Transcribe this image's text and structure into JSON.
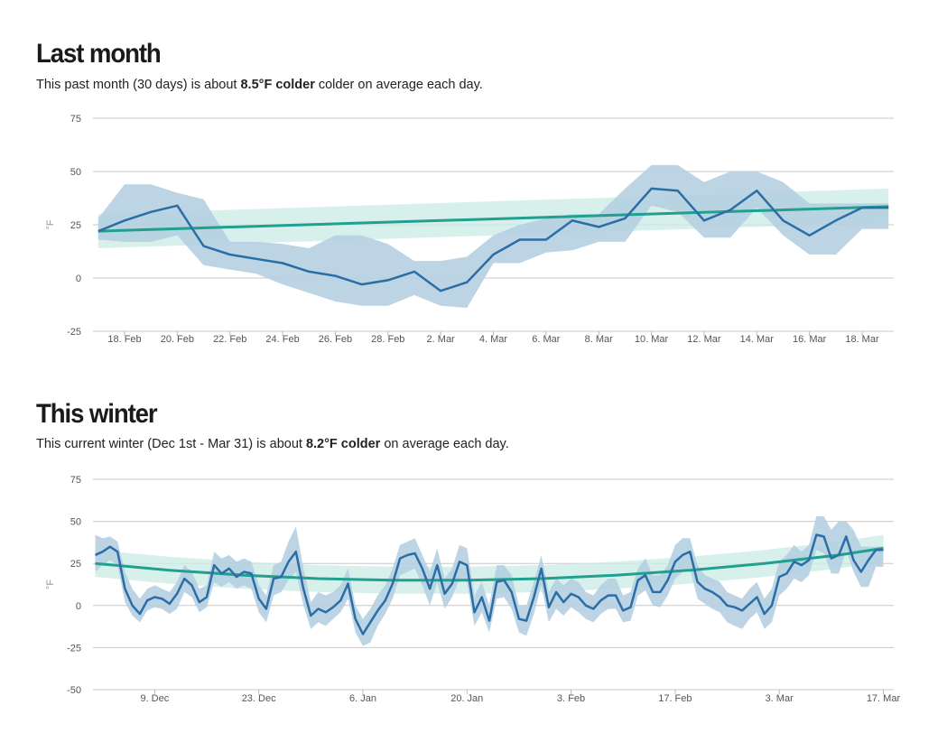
{
  "sections": [
    {
      "heading": "Last month",
      "desc_pre": "This past month (30 days) is about ",
      "desc_bold": "8.5°F colder",
      "desc_post": " colder on average each day."
    },
    {
      "heading": "This winter",
      "desc_pre": "This current winter (Dec 1st - Mar 31) is about ",
      "desc_bold": "8.2°F colder",
      "desc_post": " on average each day."
    }
  ],
  "colors": {
    "line": "#2b6ea6",
    "band": "#b5cfe1",
    "normal": "#20a08f",
    "normal_band": "#cdece6",
    "grid": "#c8c8c8"
  },
  "chart_data": [
    {
      "type": "line",
      "ylabel": "°F",
      "ylim": [
        -25,
        75
      ],
      "yticks": [
        -25,
        0,
        25,
        50,
        75
      ],
      "x_start": 16.8,
      "x_end": 47.2,
      "x_unit": "days since Feb 1",
      "xticks": [
        {
          "x": 18,
          "label": "18. Feb"
        },
        {
          "x": 20,
          "label": "20. Feb"
        },
        {
          "x": 22,
          "label": "22. Feb"
        },
        {
          "x": 24,
          "label": "24. Feb"
        },
        {
          "x": 26,
          "label": "26. Feb"
        },
        {
          "x": 28,
          "label": "28. Feb"
        },
        {
          "x": 30,
          "label": "2. Mar"
        },
        {
          "x": 32,
          "label": "4. Mar"
        },
        {
          "x": 34,
          "label": "6. Mar"
        },
        {
          "x": 36,
          "label": "8. Mar"
        },
        {
          "x": 38,
          "label": "10. Mar"
        },
        {
          "x": 40,
          "label": "12. Mar"
        },
        {
          "x": 42,
          "label": "14. Mar"
        },
        {
          "x": 44,
          "label": "16. Mar"
        },
        {
          "x": 46,
          "label": "18. Mar"
        }
      ],
      "series": [
        {
          "x": [
            17,
            18,
            19,
            20,
            21,
            22,
            23,
            24,
            25,
            26,
            27,
            28,
            29,
            30,
            31,
            32,
            33,
            34,
            35,
            36,
            37,
            38,
            39,
            40,
            41,
            42,
            43,
            44,
            45,
            46,
            47
          ],
          "y": [
            22,
            27,
            31,
            34,
            15,
            11,
            9,
            7,
            3,
            1,
            -3,
            -1,
            3,
            -6,
            -2,
            11,
            18,
            18,
            27,
            24,
            28,
            42,
            41,
            27,
            32,
            41,
            27,
            20,
            27,
            33,
            33
          ],
          "low": [
            18,
            17,
            17,
            20,
            6,
            4,
            2,
            -3,
            -7,
            -11,
            -13,
            -13,
            -8,
            -13,
            -14,
            7,
            7,
            12,
            13,
            17,
            17,
            34,
            31,
            19,
            19,
            33,
            20,
            11,
            11,
            23,
            23
          ],
          "high": [
            28,
            44,
            44,
            40,
            37,
            17,
            17,
            16,
            14,
            20,
            20,
            16,
            8,
            8,
            10,
            20,
            25,
            28,
            30,
            30,
            42,
            53,
            53,
            45,
            50,
            50,
            45,
            35,
            35,
            35,
            35
          ]
        }
      ],
      "normal": {
        "x": [
          17,
          47
        ],
        "y": [
          22,
          33.5
        ],
        "low": [
          14,
          26
        ],
        "high": [
          30,
          42
        ]
      }
    },
    {
      "type": "line",
      "ylabel": "°F",
      "ylim": [
        -50,
        75
      ],
      "yticks": [
        -50,
        -25,
        0,
        25,
        50,
        75
      ],
      "x_start": -0.3,
      "x_end": 107.4,
      "x_unit": "days since Dec 1",
      "xticks": [
        {
          "x": 8,
          "label": "9. Dec"
        },
        {
          "x": 22,
          "label": "23. Dec"
        },
        {
          "x": 36,
          "label": "6. Jan"
        },
        {
          "x": 50,
          "label": "20. Jan"
        },
        {
          "x": 64,
          "label": "3. Feb"
        },
        {
          "x": 78,
          "label": "17. Feb"
        },
        {
          "x": 92,
          "label": "3. Mar"
        },
        {
          "x": 106,
          "label": "17. Mar"
        }
      ],
      "series": [
        {
          "x": [
            0,
            1,
            2,
            3,
            4,
            5,
            6,
            7,
            8,
            9,
            10,
            11,
            12,
            13,
            14,
            15,
            16,
            17,
            18,
            19,
            20,
            21,
            22,
            23,
            24,
            25,
            26,
            27,
            28,
            29,
            30,
            31,
            32,
            33,
            34,
            35,
            36,
            37,
            38,
            39,
            40,
            41,
            42,
            43,
            44,
            45,
            46,
            47,
            48,
            49,
            50,
            51,
            52,
            53,
            54,
            55,
            56,
            57,
            58,
            59,
            60,
            61,
            62,
            63,
            64,
            65,
            66,
            67,
            68,
            69,
            70,
            71,
            72,
            73,
            74,
            75,
            76,
            77,
            78,
            79,
            80,
            81,
            82,
            83,
            84,
            85,
            86,
            87,
            88,
            89,
            90,
            91,
            92,
            93,
            94,
            95,
            96,
            97,
            98,
            99,
            100,
            101,
            102,
            103,
            104,
            105,
            106
          ],
          "y": [
            30,
            32,
            35,
            32,
            10,
            0,
            -5,
            3,
            5,
            4,
            1,
            7,
            16,
            12,
            2,
            5,
            24,
            19,
            22,
            17,
            20,
            19,
            4,
            -2,
            16,
            17,
            26,
            32,
            10,
            -6,
            -2,
            -4,
            -1,
            3,
            13,
            -8,
            -17,
            -10,
            -3,
            3,
            13,
            28,
            30,
            31,
            22,
            10,
            24,
            7,
            13,
            26,
            24,
            -4,
            5,
            -9,
            14,
            15,
            8,
            -8,
            -9,
            5,
            22,
            -1,
            8,
            2,
            7,
            5,
            0,
            -2,
            3,
            6,
            6,
            -3,
            -1,
            15,
            18,
            8,
            8,
            15,
            26,
            30,
            32,
            14,
            10,
            8,
            5,
            0,
            -1,
            -3,
            1,
            5,
            -5,
            0,
            17,
            19,
            26,
            24,
            27,
            42,
            41,
            28,
            30,
            41,
            27,
            20,
            27,
            33,
            33
          ],
          "low": [
            20,
            24,
            27,
            24,
            2,
            -6,
            -10,
            -3,
            -1,
            -2,
            -5,
            -2,
            8,
            5,
            -4,
            -1,
            14,
            11,
            14,
            10,
            12,
            10,
            -4,
            -10,
            6,
            8,
            15,
            20,
            0,
            -14,
            -10,
            -12,
            -8,
            -4,
            4,
            -16,
            -24,
            -22,
            -12,
            -5,
            4,
            18,
            20,
            22,
            12,
            0,
            14,
            -2,
            5,
            16,
            14,
            -12,
            -4,
            -16,
            4,
            5,
            -2,
            -16,
            -18,
            -5,
            12,
            -10,
            -2,
            -6,
            -1,
            -4,
            -8,
            -10,
            -5,
            -2,
            -2,
            -10,
            -9,
            6,
            9,
            0,
            -1,
            6,
            16,
            20,
            22,
            4,
            1,
            -2,
            -4,
            -10,
            -12,
            -14,
            -8,
            -4,
            -14,
            -10,
            6,
            10,
            16,
            14,
            18,
            33,
            31,
            19,
            19,
            33,
            20,
            11,
            11,
            23,
            23
          ],
          "high": [
            42,
            40,
            41,
            38,
            20,
            10,
            4,
            10,
            12,
            10,
            8,
            14,
            24,
            20,
            10,
            12,
            32,
            28,
            30,
            26,
            28,
            26,
            12,
            6,
            24,
            26,
            38,
            47,
            22,
            2,
            8,
            6,
            8,
            12,
            22,
            0,
            -8,
            -2,
            6,
            12,
            22,
            36,
            38,
            40,
            30,
            20,
            34,
            16,
            22,
            36,
            34,
            6,
            14,
            0,
            24,
            24,
            18,
            0,
            0,
            14,
            30,
            8,
            16,
            12,
            16,
            14,
            8,
            6,
            12,
            16,
            16,
            6,
            8,
            22,
            28,
            18,
            18,
            24,
            36,
            40,
            40,
            24,
            18,
            16,
            14,
            8,
            6,
            4,
            10,
            14,
            4,
            10,
            26,
            30,
            36,
            32,
            36,
            53,
            53,
            45,
            50,
            50,
            45,
            35,
            35,
            35,
            35
          ]
        }
      ],
      "normal": {
        "x": [
          0,
          10,
          20,
          30,
          40,
          50,
          60,
          70,
          80,
          90,
          100,
          106
        ],
        "y": [
          25,
          21,
          18,
          16,
          15,
          15,
          16,
          18,
          21,
          25,
          30,
          34
        ],
        "low": [
          17,
          13,
          10,
          8,
          7,
          7,
          8,
          10,
          13,
          17,
          22,
          26
        ],
        "high": [
          33,
          29,
          26,
          24,
          23,
          23,
          24,
          26,
          29,
          33,
          38,
          42
        ]
      }
    }
  ]
}
